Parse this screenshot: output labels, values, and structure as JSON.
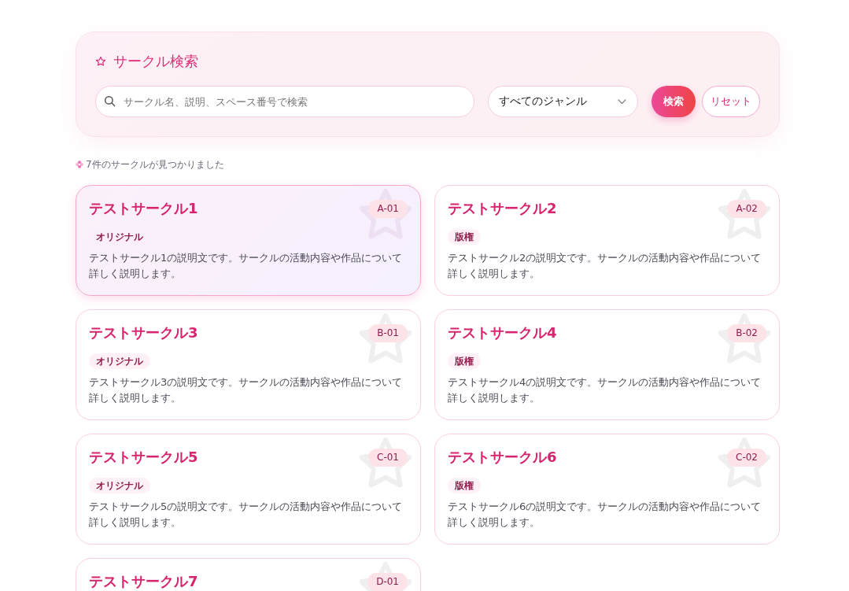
{
  "search_panel": {
    "title": "サークル検索",
    "search": {
      "placeholder": "サークル名、説明、スペース番号で検索"
    },
    "genre_select": {
      "value": "すべてのジャンル"
    },
    "buttons": [
      {
        "label": "検索",
        "kind": "primary"
      },
      {
        "label": "リセット",
        "kind": "secondary"
      }
    ]
  },
  "result_count": "7件のサークルが見つかりました",
  "circles": [
    {
      "name": "テストサークル1",
      "space": "A-01",
      "genre": "オリジナル",
      "description": "テストサークル1の説明文です。サークルの活動内容や作品について詳しく説明します。",
      "selected": true
    },
    {
      "name": "テストサークル2",
      "space": "A-02",
      "genre": "版権",
      "description": "テストサークル2の説明文です。サークルの活動内容や作品について詳しく説明します。",
      "selected": false
    },
    {
      "name": "テストサークル3",
      "space": "B-01",
      "genre": "オリジナル",
      "description": "テストサークル3の説明文です。サークルの活動内容や作品について詳しく説明します。",
      "selected": false
    },
    {
      "name": "テストサークル4",
      "space": "B-02",
      "genre": "版権",
      "description": "テストサークル4の説明文です。サークルの活動内容や作品について詳しく説明します。",
      "selected": false
    },
    {
      "name": "テストサークル5",
      "space": "C-01",
      "genre": "オリジナル",
      "description": "テストサークル5の説明文です。サークルの活動内容や作品について詳しく説明します。",
      "selected": false
    },
    {
      "name": "テストサークル6",
      "space": "C-02",
      "genre": "版権",
      "description": "テストサークル6の説明文です。サークルの活動内容や作品について詳しく説明します。",
      "selected": false
    },
    {
      "name": "テストサークル7",
      "space": "D-01",
      "selected": false
    }
  ]
}
